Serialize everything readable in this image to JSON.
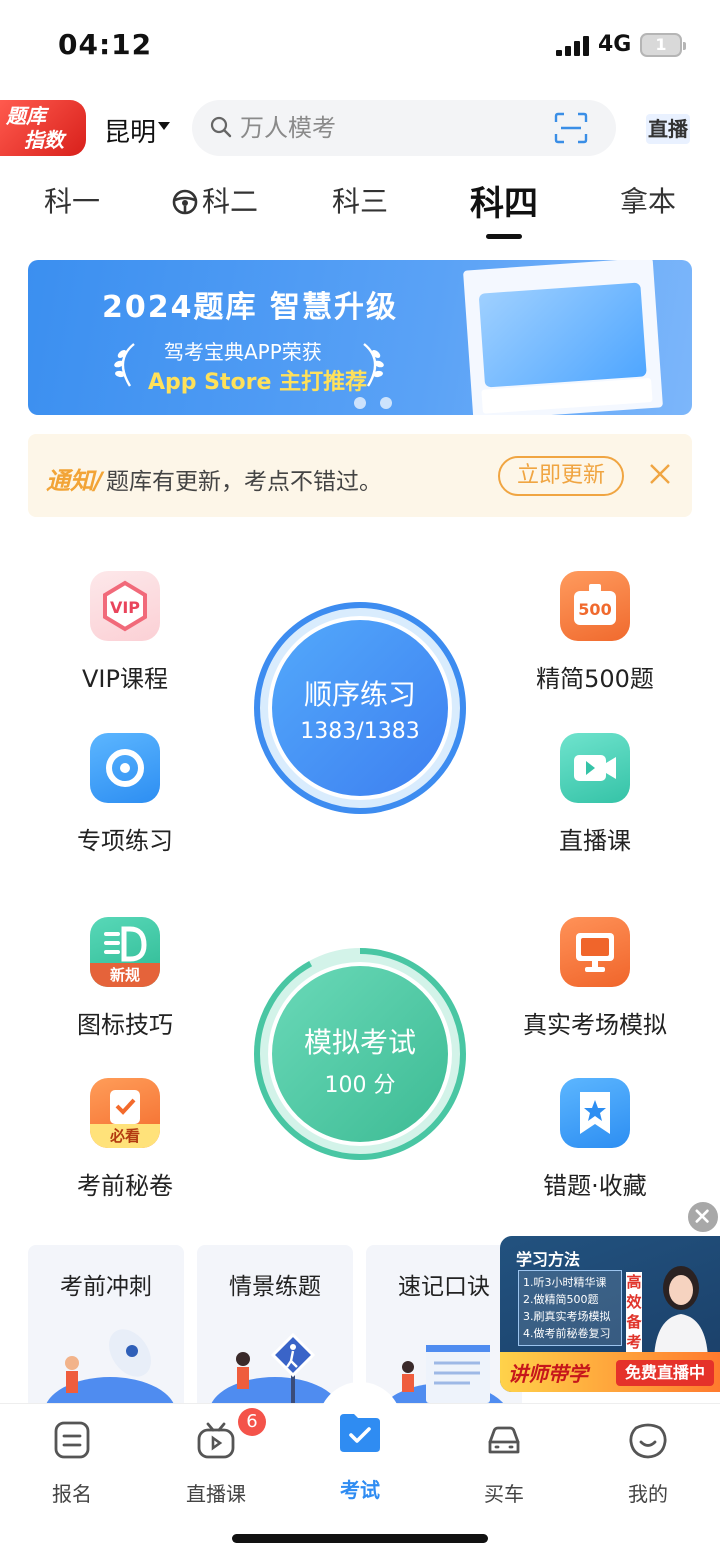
{
  "status_bar": {
    "time": "04:12",
    "network": "4G",
    "battery": "1"
  },
  "header": {
    "logo_line1": "题库",
    "logo_line2": "指数",
    "city": "昆明",
    "search_placeholder": "万人模考",
    "live_label": "直播"
  },
  "tabs": [
    {
      "label": "科一",
      "active": false
    },
    {
      "label": "科二",
      "active": false,
      "icon": "steering-wheel-icon"
    },
    {
      "label": "科三",
      "active": false
    },
    {
      "label": "科四",
      "active": true
    },
    {
      "label": "拿本",
      "active": false
    }
  ],
  "banner": {
    "title": "2024题库 智慧升级",
    "subtitle": "驾考宝典APP荣获",
    "highlight": "App Store 主打推荐"
  },
  "notice": {
    "tag": "通知/",
    "text": "题库有更新，考点不错过。",
    "button": "立即更新"
  },
  "features": {
    "vip": "VIP课程",
    "special": "专项练习",
    "jingjian": "精简500题",
    "live_course": "直播课",
    "icon_tips": "图标技巧",
    "icon_tips_badge": "新规",
    "secret": "考前秘卷",
    "secret_badge": "必看",
    "real_exam": "真实考场模拟",
    "wrong": "错题·收藏",
    "vip_icon_text": "VIP",
    "jingjian_icon_text": "500"
  },
  "practice": {
    "title": "顺序练习",
    "progress": "1383/1383",
    "progress_ratio": 1.0
  },
  "mock": {
    "title": "模拟考试",
    "score": "100 分",
    "progress_ratio": 0.92
  },
  "cards": [
    {
      "title": "考前冲刺"
    },
    {
      "title": "情景练题"
    },
    {
      "title": "速记口诀"
    }
  ],
  "float_ad": {
    "head": "学习方法",
    "items": [
      "1.听3小时精华课",
      "2.做精简500题",
      "3.刷真实考场模拟",
      "4.做考前秘卷复习"
    ],
    "vertical": "高效备考",
    "left_text": "讲师带学",
    "right_text": "免费直播中"
  },
  "bottom_nav": [
    {
      "label": "报名",
      "icon": "signup-icon"
    },
    {
      "label": "直播课",
      "icon": "tv-icon",
      "badge": "6"
    },
    {
      "label": "考试",
      "icon": "exam-folder-icon",
      "active": true
    },
    {
      "label": "买车",
      "icon": "car-icon"
    },
    {
      "label": "我的",
      "icon": "smile-icon"
    }
  ],
  "colors": {
    "accent_blue": "#2f8cf2",
    "ring_green": "#49c6a3",
    "notice_orange": "#f0a542",
    "badge_red": "#f4534a"
  }
}
